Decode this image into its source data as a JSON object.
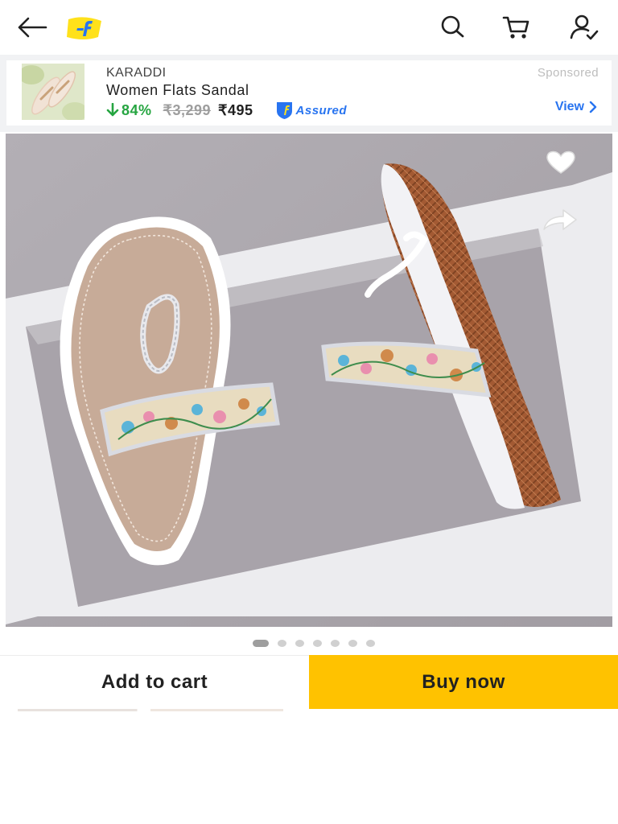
{
  "topbar": {
    "back_icon": "arrow-left-icon",
    "logo_icon": "flipkart-logo-icon",
    "search_icon": "search-icon",
    "cart_icon": "cart-icon",
    "account_icon": "account-icon"
  },
  "ad": {
    "brand": "KARADDI",
    "title": "Women Flats Sandal",
    "discount": "84%",
    "mrp": "₹3,299",
    "price": "₹495",
    "assured_label": "Assured",
    "sponsored_label": "Sponsored",
    "view_label": "View"
  },
  "product": {
    "wishlist_icon": "heart-icon",
    "share_icon": "share-icon",
    "image_count": 7,
    "active_image": 1
  },
  "actions": {
    "add_to_cart_label": "Add to cart",
    "buy_now_label": "Buy now"
  },
  "colors": {
    "buy_button": "#ffc200",
    "discount_green": "#26a541",
    "link_blue": "#2874f0"
  }
}
